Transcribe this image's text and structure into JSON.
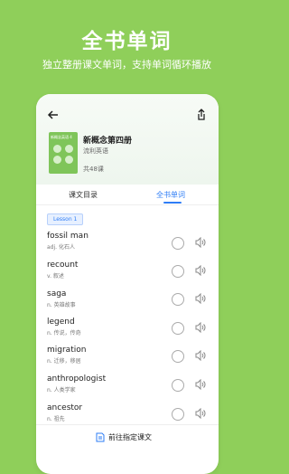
{
  "headline": "全书单词",
  "subline": "独立整册课文单词，支持单词循环播放",
  "book": {
    "cover_text": "新概念英语 4",
    "title": "新概念第四册",
    "publisher": "流利英语",
    "lesson_count": "共48课"
  },
  "tabs": [
    {
      "label": "课文目录",
      "active": false
    },
    {
      "label": "全书单词",
      "active": true
    }
  ],
  "lesson_tag": "Lesson 1",
  "words": [
    {
      "word": "fossil man",
      "def": "adj. 化石人"
    },
    {
      "word": "recount",
      "def": "v. 叙述"
    },
    {
      "word": "saga",
      "def": "n. 英雄故事"
    },
    {
      "word": "legend",
      "def": "n. 传说，传奇"
    },
    {
      "word": "migration",
      "def": "n. 迁移，移居"
    },
    {
      "word": "anthropologist",
      "def": "n. 人类学家"
    },
    {
      "word": "ancestor",
      "def": "n. 祖先"
    }
  ],
  "bottom_button": "前往指定课文",
  "colors": {
    "background": "#8fcf5a",
    "accent": "#2e7df6",
    "cover": "#7fc55a"
  },
  "icons": {
    "back": "back-arrow-icon",
    "share": "share-icon",
    "play": "play-circle-icon",
    "speaker": "speaker-icon",
    "goto": "document-icon"
  }
}
